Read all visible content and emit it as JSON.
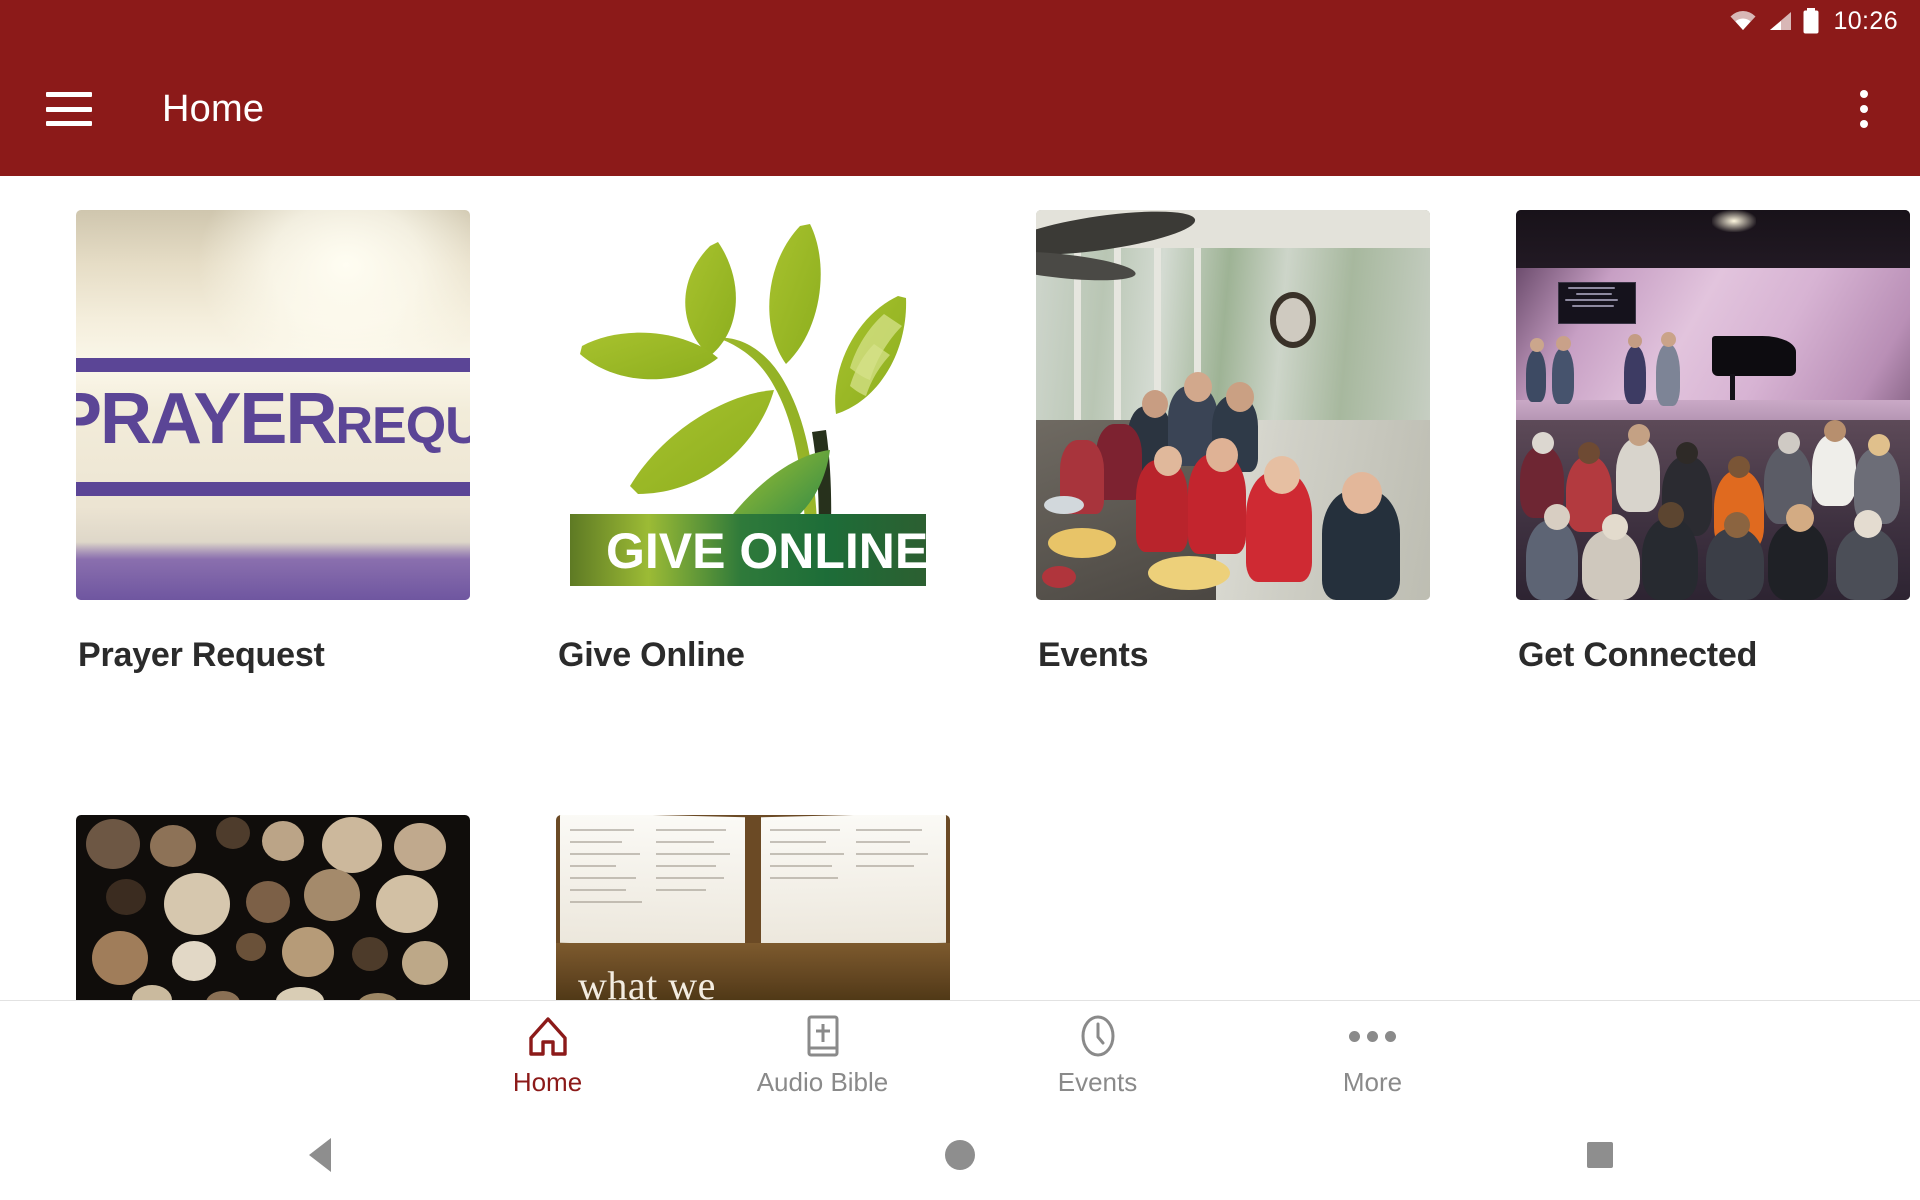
{
  "status_bar": {
    "time": "10:26",
    "icons": [
      "wifi-icon",
      "cellular-signal-icon",
      "battery-icon"
    ]
  },
  "app_bar": {
    "menu_icon": "hamburger-menu-icon",
    "title": "Home",
    "overflow_icon": "overflow-menu-icon",
    "background_color": "#8C1A19"
  },
  "main": {
    "tiles": [
      {
        "label": "Prayer Request",
        "image": "prayer-request-banner"
      },
      {
        "label": "Give Online",
        "image": "give-online-logo",
        "banner_text": "GIVE ONLINE"
      },
      {
        "label": "Events",
        "image": "fellowship-meal-photo"
      },
      {
        "label": "Get Connected",
        "image": "church-sanctuary-photo"
      },
      {
        "label": "",
        "image": "wood-logs-photo"
      },
      {
        "label": "",
        "image": "open-bible-photo",
        "overlay_text": "what we"
      }
    ]
  },
  "bottom_nav": {
    "items": [
      {
        "label": "Home",
        "icon": "home-church-icon",
        "active": true
      },
      {
        "label": "Audio Bible",
        "icon": "bible-book-icon",
        "active": false
      },
      {
        "label": "Events",
        "icon": "clock-icon",
        "active": false
      },
      {
        "label": "More",
        "icon": "more-dots-icon",
        "active": false
      }
    ],
    "active_color": "#8C1A19",
    "inactive_color": "#8A8A8A"
  },
  "system_nav": {
    "buttons": [
      {
        "name": "back-button",
        "icon": "back-triangle-icon"
      },
      {
        "name": "home-button",
        "icon": "home-circle-icon"
      },
      {
        "name": "recents-button",
        "icon": "recents-square-icon"
      }
    ]
  }
}
